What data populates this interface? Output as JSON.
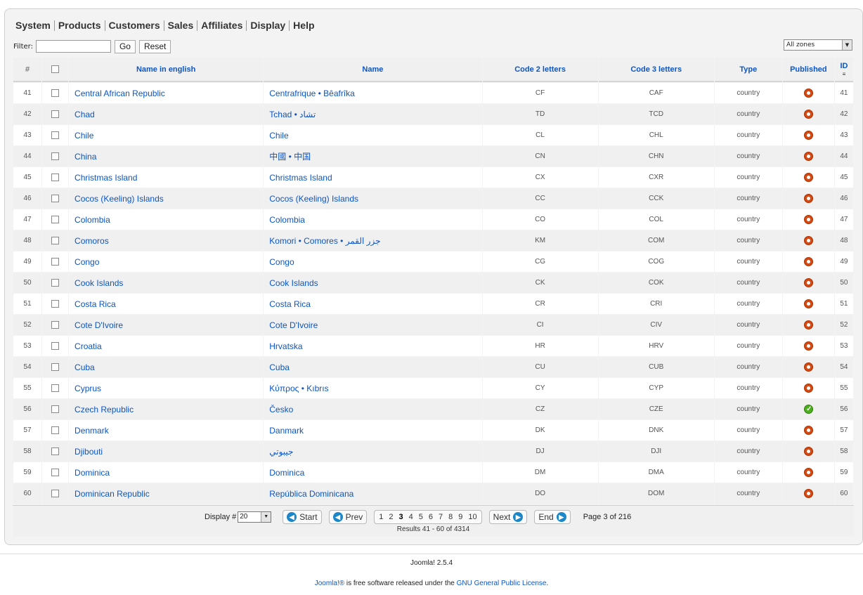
{
  "menu": [
    "System",
    "Products",
    "Customers",
    "Sales",
    "Affiliates",
    "Display",
    "Help"
  ],
  "filter": {
    "label": "Filter:",
    "value": "",
    "go_label": "Go",
    "reset_label": "Reset"
  },
  "zone_select": {
    "selected": "All zones"
  },
  "table": {
    "columns": {
      "num": "#",
      "name_english": "Name in english",
      "name": "Name",
      "code2": "Code 2 letters",
      "code3": "Code 3 letters",
      "type": "Type",
      "published": "Published",
      "id": "ID"
    },
    "rows": [
      {
        "num": "41",
        "name_en": "Central African Republic",
        "name": "Centrafrique • Bêafrîka",
        "code2": "CF",
        "code3": "CAF",
        "type": "country",
        "published": false,
        "id": "41"
      },
      {
        "num": "42",
        "name_en": "Chad",
        "name": "Tchad • تشاد",
        "code2": "TD",
        "code3": "TCD",
        "type": "country",
        "published": false,
        "id": "42"
      },
      {
        "num": "43",
        "name_en": "Chile",
        "name": "Chile",
        "code2": "CL",
        "code3": "CHL",
        "type": "country",
        "published": false,
        "id": "43"
      },
      {
        "num": "44",
        "name_en": "China",
        "name": "中國 • 中国",
        "code2": "CN",
        "code3": "CHN",
        "type": "country",
        "published": false,
        "id": "44"
      },
      {
        "num": "45",
        "name_en": "Christmas Island",
        "name": "Christmas Island",
        "code2": "CX",
        "code3": "CXR",
        "type": "country",
        "published": false,
        "id": "45"
      },
      {
        "num": "46",
        "name_en": "Cocos (Keeling) Islands",
        "name": "Cocos (Keeling) Islands",
        "code2": "CC",
        "code3": "CCK",
        "type": "country",
        "published": false,
        "id": "46"
      },
      {
        "num": "47",
        "name_en": "Colombia",
        "name": "Colombia",
        "code2": "CO",
        "code3": "COL",
        "type": "country",
        "published": false,
        "id": "47"
      },
      {
        "num": "48",
        "name_en": "Comoros",
        "name": "Komori • Comores • جزر القمر",
        "code2": "KM",
        "code3": "COM",
        "type": "country",
        "published": false,
        "id": "48"
      },
      {
        "num": "49",
        "name_en": "Congo",
        "name": "Congo",
        "code2": "CG",
        "code3": "COG",
        "type": "country",
        "published": false,
        "id": "49"
      },
      {
        "num": "50",
        "name_en": "Cook Islands",
        "name": "Cook Islands",
        "code2": "CK",
        "code3": "COK",
        "type": "country",
        "published": false,
        "id": "50"
      },
      {
        "num": "51",
        "name_en": "Costa Rica",
        "name": "Costa Rica",
        "code2": "CR",
        "code3": "CRI",
        "type": "country",
        "published": false,
        "id": "51"
      },
      {
        "num": "52",
        "name_en": "Cote D'Ivoire",
        "name": "Cote D'Ivoire",
        "code2": "CI",
        "code3": "CIV",
        "type": "country",
        "published": false,
        "id": "52"
      },
      {
        "num": "53",
        "name_en": "Croatia",
        "name": "Hrvatska",
        "code2": "HR",
        "code3": "HRV",
        "type": "country",
        "published": false,
        "id": "53"
      },
      {
        "num": "54",
        "name_en": "Cuba",
        "name": "Cuba",
        "code2": "CU",
        "code3": "CUB",
        "type": "country",
        "published": false,
        "id": "54"
      },
      {
        "num": "55",
        "name_en": "Cyprus",
        "name": "Κύπρος • Kıbrıs",
        "code2": "CY",
        "code3": "CYP",
        "type": "country",
        "published": false,
        "id": "55"
      },
      {
        "num": "56",
        "name_en": "Czech Republic",
        "name": "Česko",
        "code2": "CZ",
        "code3": "CZE",
        "type": "country",
        "published": true,
        "id": "56"
      },
      {
        "num": "57",
        "name_en": "Denmark",
        "name": "Danmark",
        "code2": "DK",
        "code3": "DNK",
        "type": "country",
        "published": false,
        "id": "57"
      },
      {
        "num": "58",
        "name_en": "Djibouti",
        "name": "جيبوتي",
        "code2": "DJ",
        "code3": "DJI",
        "type": "country",
        "published": false,
        "id": "58"
      },
      {
        "num": "59",
        "name_en": "Dominica",
        "name": "Dominica",
        "code2": "DM",
        "code3": "DMA",
        "type": "country",
        "published": false,
        "id": "59"
      },
      {
        "num": "60",
        "name_en": "Dominican Republic",
        "name": "República Dominicana",
        "code2": "DO",
        "code3": "DOM",
        "type": "country",
        "published": false,
        "id": "60"
      }
    ]
  },
  "pagination": {
    "display_label": "Display #",
    "display_value": "20",
    "start_label": "Start",
    "prev_label": "Prev",
    "pages": [
      "1",
      "2",
      "3",
      "4",
      "5",
      "6",
      "7",
      "8",
      "9",
      "10"
    ],
    "current_page": "3",
    "next_label": "Next",
    "end_label": "End",
    "page_info": "Page 3 of 216",
    "results": "Results 41 - 60 of 4314"
  },
  "footer": {
    "version": "Joomla! 2.5.4",
    "license_link1": "Joomla!®",
    "license_text": " is free software released under the ",
    "license_link2": "GNU General Public License",
    "license_end": "."
  },
  "colors": {
    "link": "#0b55c4",
    "unpublished": "#d9480f",
    "published": "#4caf1c",
    "accent_arrow": "#1b86c8"
  }
}
